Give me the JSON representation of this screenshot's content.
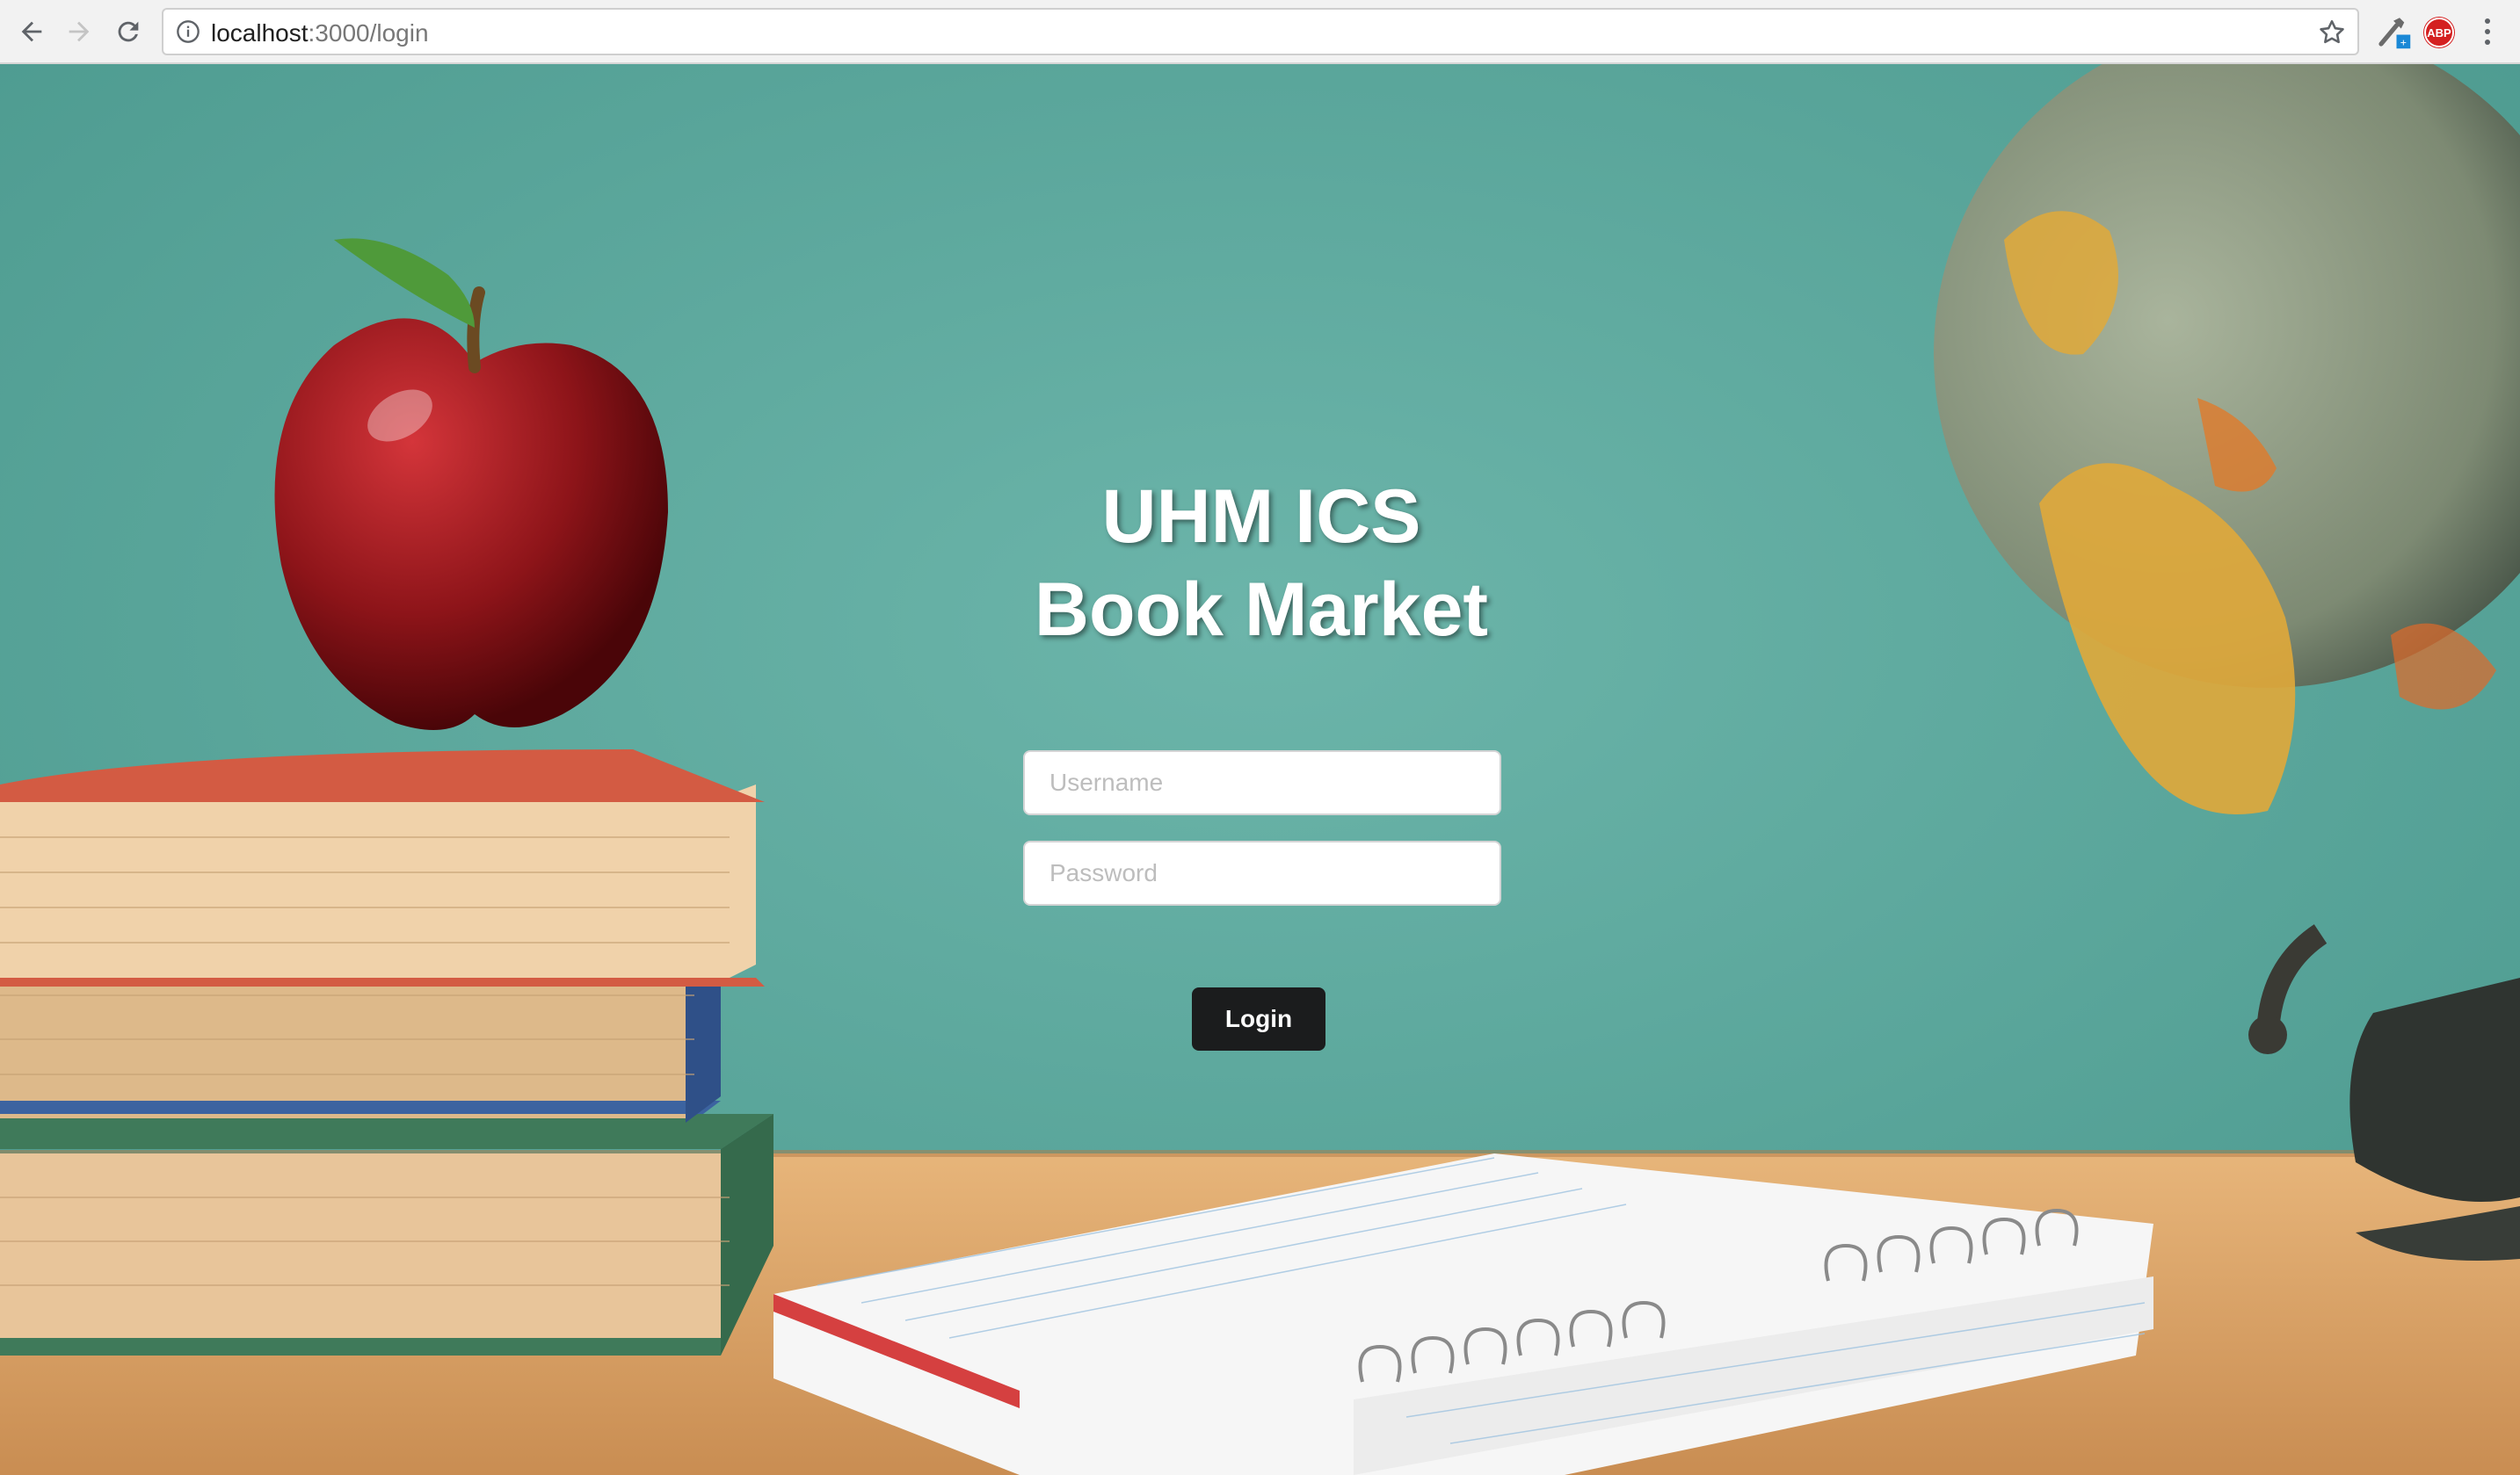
{
  "browser": {
    "url_host": "localhost",
    "url_path": ":3000/login",
    "extension_badge": "ABP"
  },
  "login": {
    "title_line1": "UHM ICS",
    "title_line2": "Book Market",
    "username_placeholder": "Username",
    "password_placeholder": "Password",
    "username_value": "",
    "password_value": "",
    "submit_label": "Login"
  },
  "colors": {
    "chalkboard": "#5aa79c",
    "button": "#1b1c1d",
    "desk": "#d9a064"
  },
  "icons": [
    "back-arrow-icon",
    "forward-arrow-icon",
    "reload-icon",
    "info-icon",
    "bookmark-star-icon",
    "extension-icon",
    "adblock-icon",
    "menu-kebab-icon"
  ]
}
